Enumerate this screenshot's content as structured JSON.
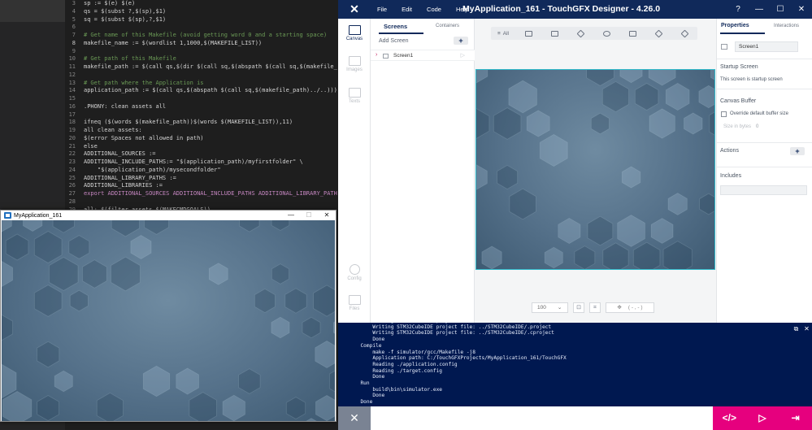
{
  "editor": {
    "lines": [
      {
        "num": "3",
        "text": "sp := $(e) $(e)",
        "style": ""
      },
      {
        "num": "4",
        "text": "qs = $(subst ?,$(sp),$1)",
        "style": ""
      },
      {
        "num": "5",
        "text": "sq = $(subst $(sp),?,$1)",
        "style": ""
      },
      {
        "num": "6",
        "text": "",
        "style": ""
      },
      {
        "num": "7",
        "text": "# Get name of this Makefile (avoid getting word 0 and a starting space)",
        "style": "comment"
      },
      {
        "num": "8",
        "text": "makefile_name := $(wordlist 1,1000,$(MAKEFILE_LIST))",
        "style": ""
      },
      {
        "num": "9",
        "text": "",
        "style": ""
      },
      {
        "num": "10",
        "text": "# Get path of this Makefile",
        "style": "comment"
      },
      {
        "num": "11",
        "text": "makefile_path := $(call qs,$(dir $(call sq,$(abspath $(call sq,$(makefile_name)))))",
        "style": ""
      },
      {
        "num": "12",
        "text": "",
        "style": ""
      },
      {
        "num": "13",
        "text": "# Get path where the Application is",
        "style": "comment"
      },
      {
        "num": "14",
        "text": "application_path := $(call qs,$(abspath $(call sq,$(makefile_path)../..)))",
        "style": ""
      },
      {
        "num": "15",
        "text": "",
        "style": ""
      },
      {
        "num": "16",
        "text": ".PHONY: clean assets all",
        "style": ""
      },
      {
        "num": "17",
        "text": "",
        "style": ""
      },
      {
        "num": "18",
        "text": "ifneq ($(words $(makefile_path))$(words $(MAKEFILE_LIST)),11)",
        "style": ""
      },
      {
        "num": "19",
        "text": "all clean assets:",
        "style": ""
      },
      {
        "num": "20",
        "text": "$(error Spaces not allowed in path)",
        "style": ""
      },
      {
        "num": "21",
        "text": "else",
        "style": ""
      },
      {
        "num": "22",
        "text": "ADDITIONAL_SOURCES :=",
        "style": ""
      },
      {
        "num": "23",
        "text": "ADDITIONAL_INCLUDE_PATHS:= \"$(application_path)/myfirstfolder\" \\",
        "style": ""
      },
      {
        "num": "24",
        "text": "    \"$(application_path)/mysecondfolder\"",
        "style": ""
      },
      {
        "num": "25",
        "text": "ADDITIONAL_LIBRARY_PATHS :=",
        "style": ""
      },
      {
        "num": "26",
        "text": "ADDITIONAL_LIBRARIES :=",
        "style": ""
      },
      {
        "num": "27",
        "text": "export ADDITIONAL_SOURCES ADDITIONAL_INCLUDE_PATHS ADDITIONAL_LIBRARY_PATHS ADDITIONAL_LIBRARIES",
        "style": "kw"
      },
      {
        "num": "28",
        "text": "",
        "style": ""
      },
      {
        "num": "29",
        "text": "all: $(filter assets,$(MAKECMDGOALS))",
        "style": ""
      }
    ]
  },
  "simulator": {
    "title": "MyApplication_161",
    "minimize": "—",
    "maximize": "☐",
    "close": "✕"
  },
  "designer": {
    "logo": "✕",
    "menu": [
      "File",
      "Edit",
      "Code",
      "Help"
    ],
    "title": "MyApplication_161 - TouchGFX Designer - 4.26.0",
    "window_controls": [
      "?",
      "—",
      "☐",
      "✕"
    ],
    "rail": [
      {
        "label": "Canvas",
        "active": true
      },
      {
        "label": "Images",
        "active": false
      },
      {
        "label": "Texts",
        "active": false
      },
      {
        "label": "Config",
        "active": false
      },
      {
        "label": "Files",
        "active": false
      }
    ],
    "screens_panel": {
      "tab_screens": "Screens",
      "tab_containers": "Containers",
      "add_screen": "Add Screen",
      "add_button": "+",
      "screen_item": "Screen1",
      "expand_glyph": "›",
      "play_glyph": "▷"
    },
    "toolbar": {
      "all_label": "All",
      "all_glyph": "≡",
      "icons": [
        "interaction-icon",
        "image-icon",
        "container-icon",
        "shape-icon",
        "text-area-icon",
        "3d-icon",
        "layers-icon"
      ]
    },
    "zoom": {
      "value": "100",
      "arrow": "⌄",
      "fit_glyph": "⊡",
      "crop_glyph": "⌗",
      "coords": "( - , - )",
      "coords_glyph": "✥"
    },
    "properties": {
      "tab_properties": "Properties",
      "tab_interactions": "Interactions",
      "name_value": "Screen1",
      "startup_heading": "Startup Screen",
      "startup_text": "This screen is startup screen",
      "canvas_buffer_heading": "Canvas Buffer",
      "override_label": "Override default buffer size",
      "size_label": "Size in bytes",
      "size_value": "0",
      "actions_heading": "Actions",
      "actions_plus": "+",
      "includes_heading": "Includes"
    },
    "console": {
      "text": "      Writing STM32CubeIDE project file: ../STM32CubeIDE/.project\n      Writing STM32CubeIDE project file: ../STM32CubeIDE/.project\n      Writing STM32CubeIDE project file: ../STM32CubeIDE/.cproject\n      Done\n  Compile\n      make -f simulator/gcc/Makefile -j8\n      Application path: C:/TouchGFXProjects/MyApplication_161/TouchGFX\n      Reading ./application.config\n      Reading ./target.config\n      Done\n  Run\n      build\\bin\\simulator.exe\n      Done\n  Done",
      "ctl_restore": "⧉",
      "ctl_close": "✕"
    },
    "bottom": {
      "close_glyph": "✕",
      "generate_code": "</>",
      "run_simulator": "▷",
      "run_target": "⇥"
    },
    "colors": {
      "title_bar": "#10295a",
      "console": "#001850",
      "accent": "#e6007e",
      "canvas_border": "#2fb8c9"
    }
  }
}
